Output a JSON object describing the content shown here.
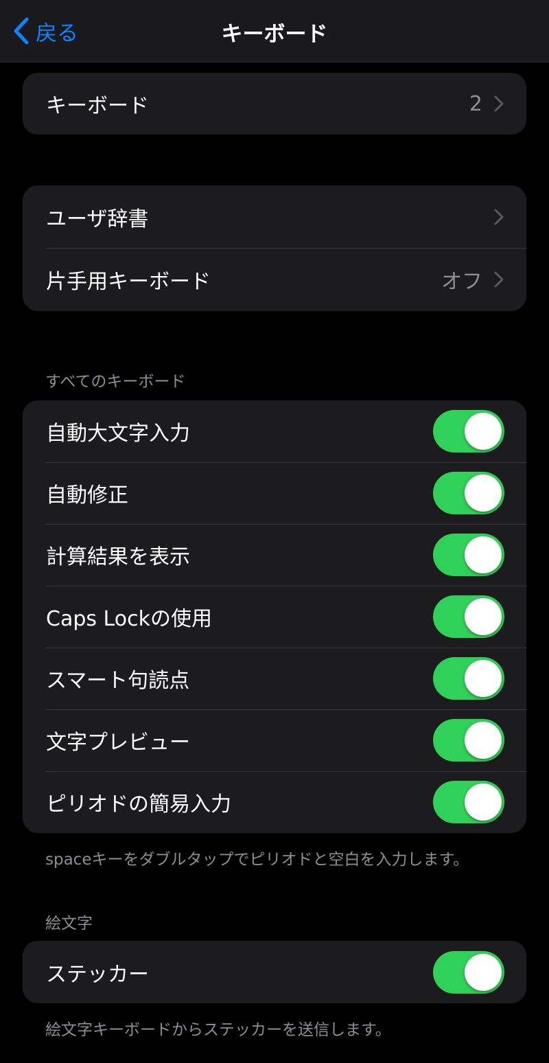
{
  "nav": {
    "back_label": "戻る",
    "title": "キーボード"
  },
  "group1": {
    "keyboards": {
      "label": "キーボード",
      "value": "2"
    }
  },
  "group2": {
    "user_dictionary": {
      "label": "ユーザ辞書"
    },
    "one_handed": {
      "label": "片手用キーボード",
      "value": "オフ"
    }
  },
  "all_keyboards": {
    "header": "すべてのキーボード",
    "items": [
      {
        "label": "自動大文字入力",
        "on": true
      },
      {
        "label": "自動修正",
        "on": true
      },
      {
        "label": "計算結果を表示",
        "on": true
      },
      {
        "label": "Caps Lockの使用",
        "on": true
      },
      {
        "label": "スマート句読点",
        "on": true
      },
      {
        "label": "文字プレビュー",
        "on": true
      },
      {
        "label": "ピリオドの簡易入力",
        "on": true
      }
    ],
    "footer": "spaceキーをダブルタップでピリオドと空白を入力します。"
  },
  "emoji": {
    "header": "絵文字",
    "stickers": {
      "label": "ステッカー",
      "on": true
    },
    "footer": "絵文字キーボードからステッカーを送信します。"
  },
  "colors": {
    "accent": "#0a84ff",
    "toggle_on": "#30d158",
    "cell_bg": "#1c1c1e",
    "secondary_text": "#8e8e93"
  }
}
